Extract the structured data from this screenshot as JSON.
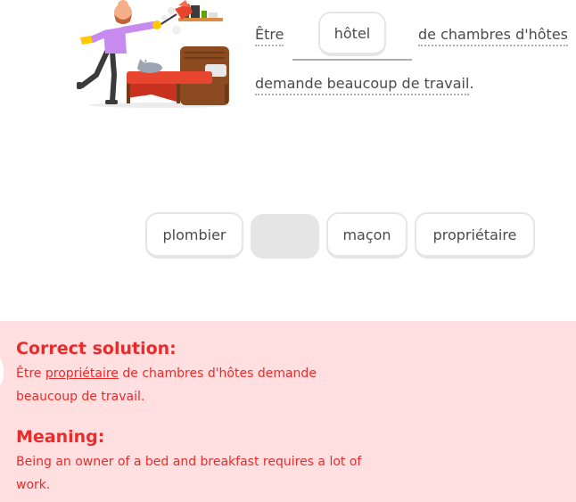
{
  "illustration": {
    "name": "man dusting near a bed with a sleeping cat"
  },
  "sentence": {
    "word1": "Être",
    "placed_chip": "hôtel",
    "word2": "de chambres d'hôtes",
    "line2": "demande beaucoup de travail",
    "period": "."
  },
  "word_bank": {
    "options": [
      "plombier",
      "maçon",
      "propriétaire"
    ]
  },
  "feedback": {
    "correct_heading": "Correct solution:",
    "solution_prefix": "Être ",
    "solution_word": "propriétaire",
    "solution_suffix": " de chambres d'hôtes demande beaucoup de travail.",
    "meaning_heading": "Meaning:",
    "meaning_text": "Being an owner of a bed and breakfast requires a lot of work."
  },
  "colors": {
    "feedback_bg": "#ffdfe0",
    "feedback_text": "#ea2b2b",
    "chip_border": "#e5e5e5",
    "text": "#4b4b4b"
  }
}
